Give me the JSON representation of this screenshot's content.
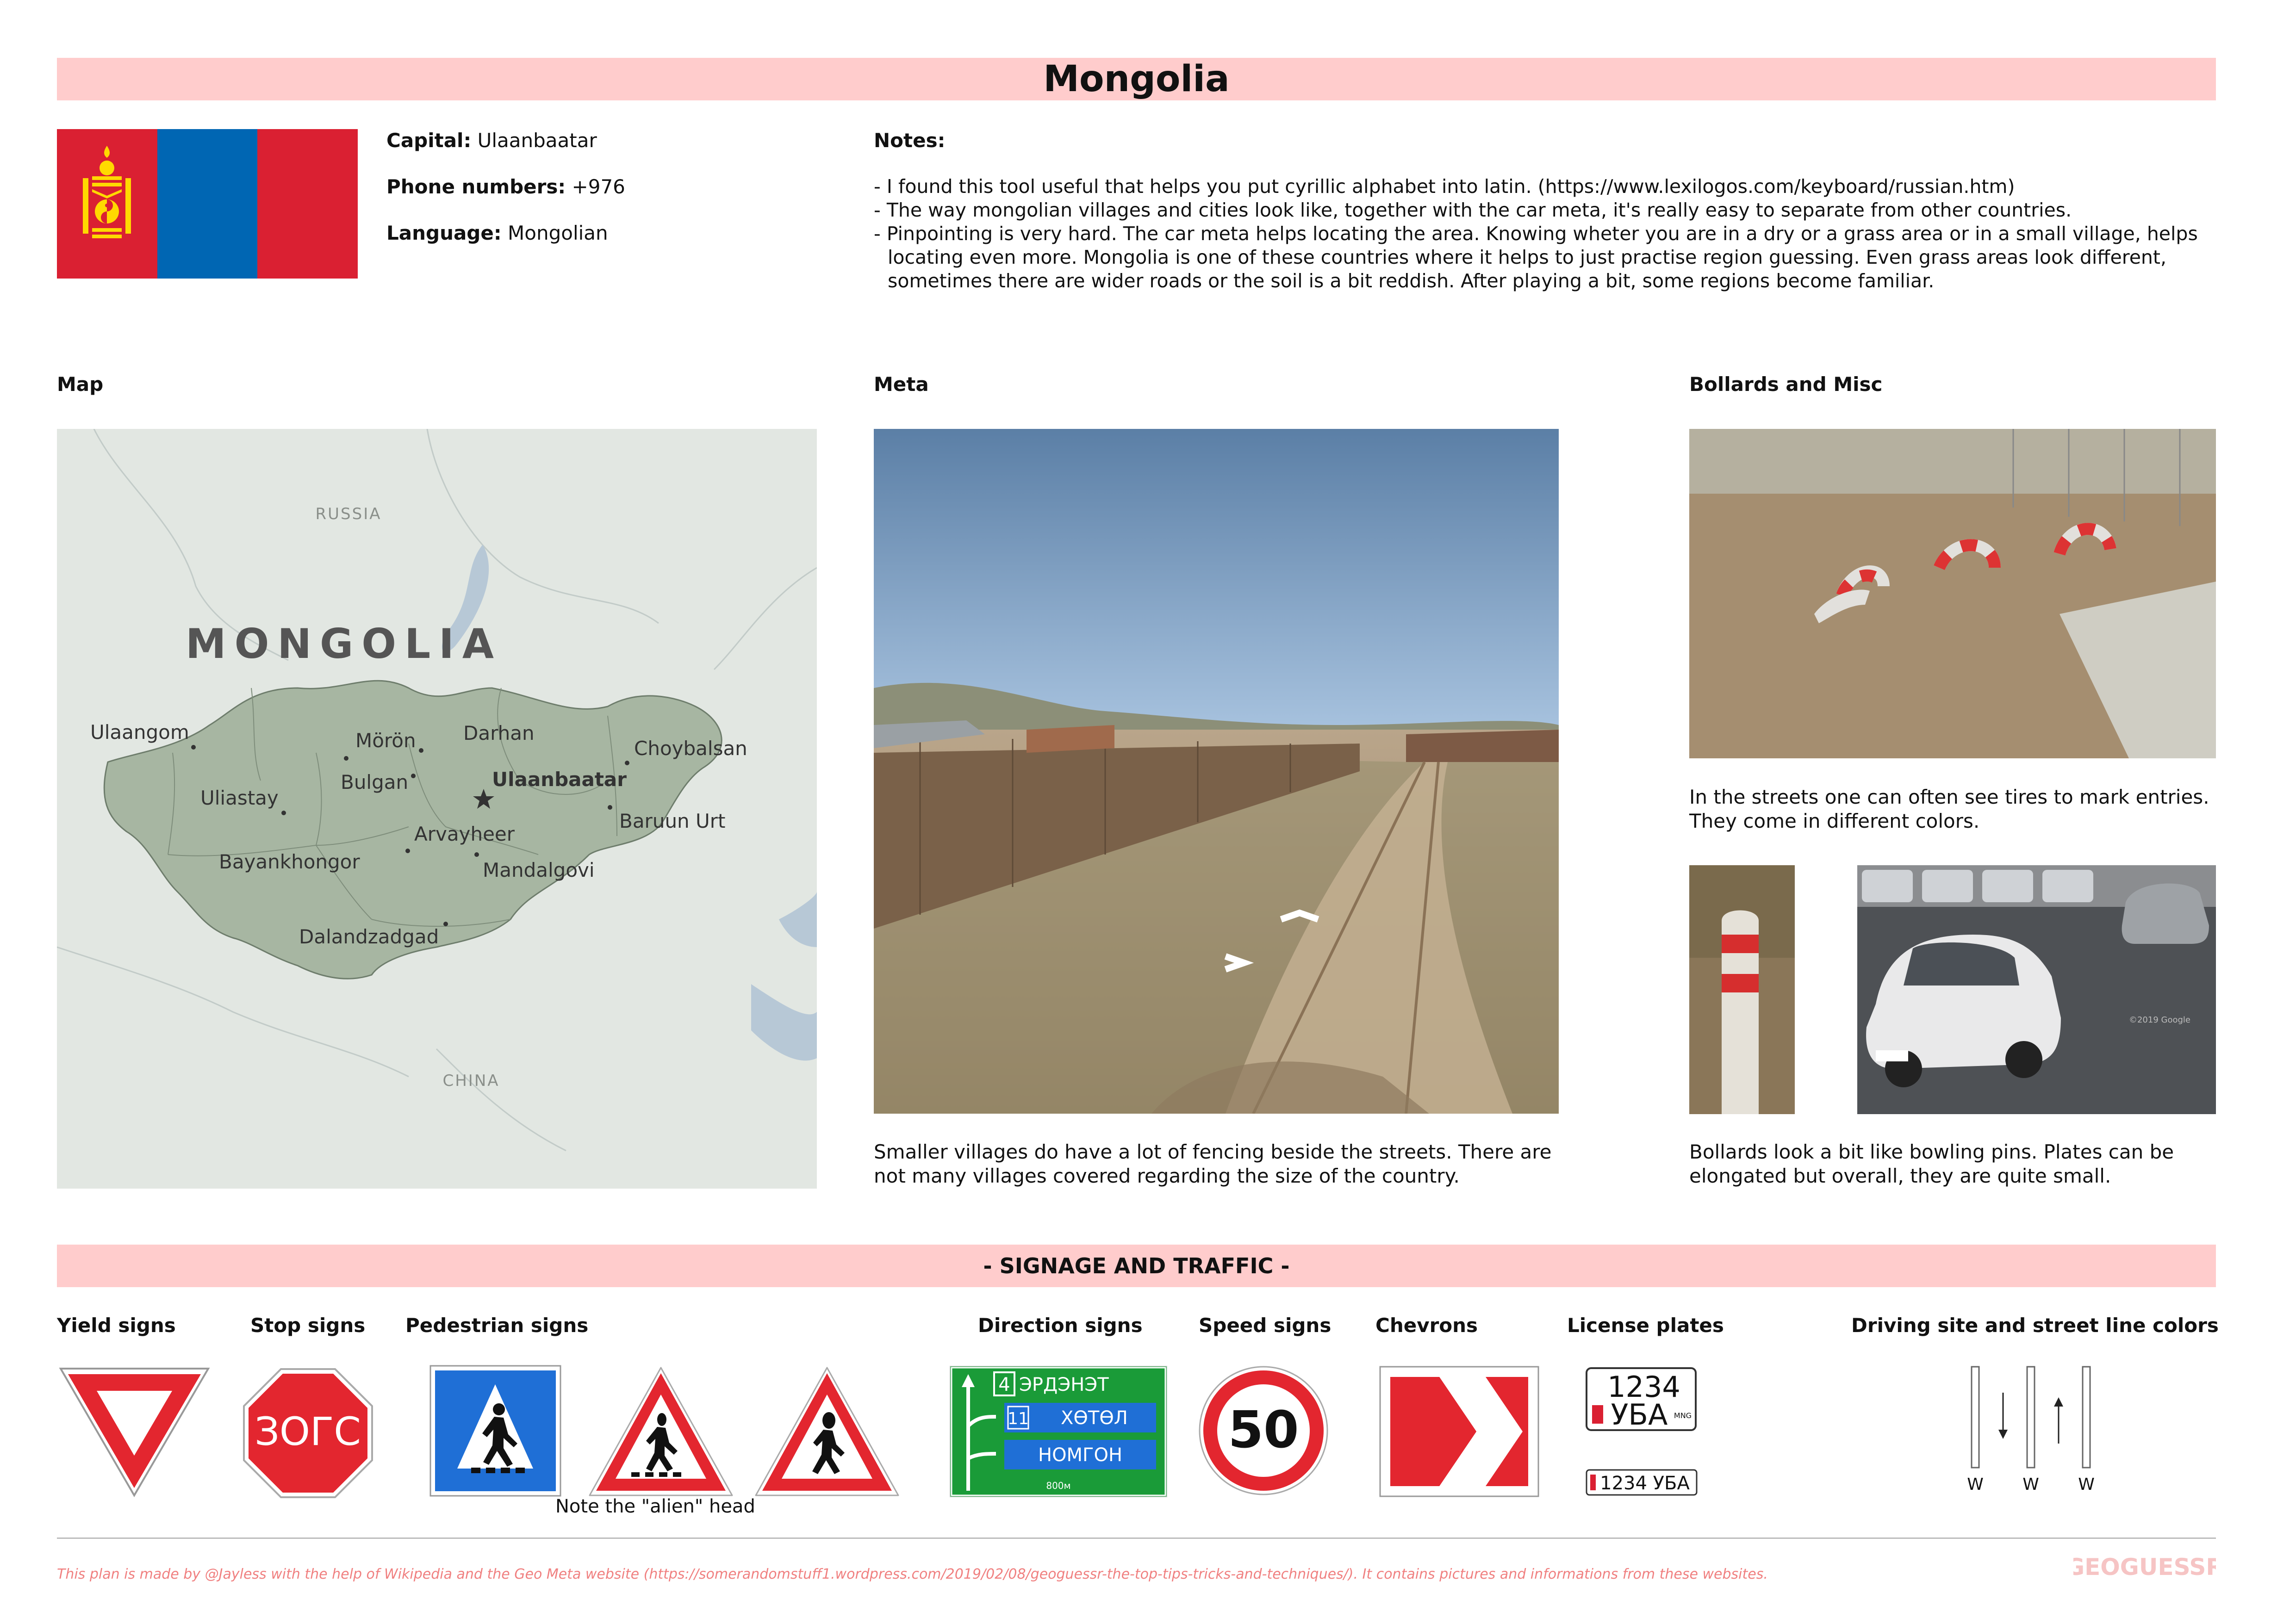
{
  "title": "Mongolia",
  "info": {
    "capital_label": "Capital:",
    "capital": "Ulaanbaatar",
    "phone_label": "Phone numbers:",
    "phone": "+976",
    "language_label": "Language:",
    "language": "Mongolian"
  },
  "notes": {
    "heading": "Notes:",
    "items": [
      "- I found this tool useful that helps you put cyrillic alphabet into latin. (https://www.lexilogos.com/keyboard/russian.htm)",
      "- The way mongolian villages and cities look like, together with the car meta, it's really easy to separate from other countries.",
      "- Pinpointing is very hard. The car meta helps locating the area. Knowing wheter you are in a dry or a grass area or in a small village, helps locating even more. Mongolia is one of these countries where it helps to just practise region guessing. Even grass areas look different, sometimes there are wider roads or the soil is a bit reddish. After playing a bit, some regions become familiar."
    ]
  },
  "sections": {
    "map": "Map",
    "meta": "Meta",
    "bollards": "Bollards and Misc"
  },
  "map": {
    "country": "MONGOLIA",
    "north": "RUSSIA",
    "south": "CHINA",
    "cities": [
      "Ulaangom",
      "Mörön",
      "Darhan",
      "Choybalsan",
      "Uliastay",
      "Bulgan",
      "Ulaanbaatar",
      "Baruun Urt",
      "Arvayheer",
      "Bayankhongor",
      "Mandalgovi",
      "Dalandzadgad"
    ]
  },
  "captions": {
    "meta": "Smaller villages do have a lot of fencing beside the streets. There are not many villages covered regarding the size of the country.",
    "tires": "In the streets one can often see tires to mark entries. They come in different colors.",
    "bollards": "Bollards look a bit like bowling pins. Plates can be elongated but overall, they are quite small.",
    "watermark": "©2019 Google"
  },
  "signage": {
    "banner": "- SIGNAGE AND TRAFFIC -",
    "yield": "Yield signs",
    "stop": "Stop signs",
    "pedestrian": "Pedestrian signs",
    "direction": "Direction signs",
    "speed": "Speed signs",
    "chevrons": "Chevrons",
    "plates": "License plates",
    "driving": "Driving site and street line colors",
    "alien_note": "Note the \"alien\" head",
    "stop_text": "ЗОГС",
    "speed_value": "50",
    "direction_lines": [
      "4",
      "ЭРДЭНЭТ",
      "11",
      "ХӨТӨЛ",
      "НОМГОН",
      "800м"
    ],
    "plate_top_number": "1234",
    "plate_top_letters": "УБА",
    "plate_small": "1234 УБА",
    "plate_code": "MNG",
    "line_labels": [
      "W",
      "W",
      "W"
    ]
  },
  "footer": {
    "text": "This plan is made by @Jayless with the help of Wikipedia and the Geo Meta website (https://somerandomstuff1.wordpress.com/2019/02/08/geoguessr-the-top-tips-tricks-and-techniques/). It contains pictures and informations from these websites.",
    "logo": "GEOGUESSR"
  },
  "colors": {
    "banner": "#ffcccc",
    "flag_red": "#da2032",
    "flag_blue": "#0066b3",
    "flag_yellow": "#ffd900",
    "sign_red": "#e3262f",
    "sign_green": "#1a9b38"
  }
}
